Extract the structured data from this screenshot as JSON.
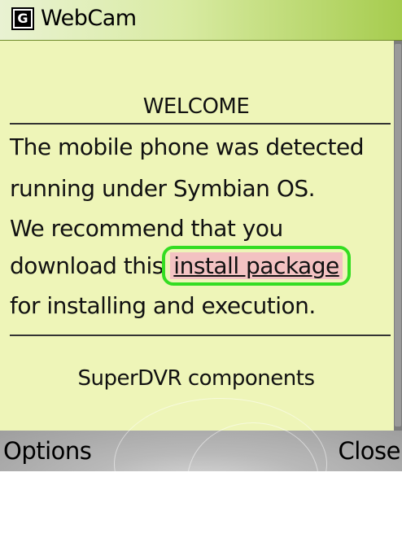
{
  "title_bar": {
    "icon_letter": "G",
    "title": "WebCam"
  },
  "content": {
    "heading": "WELCOME",
    "message": {
      "line1": "The mobile phone was detected",
      "line2": "running under Symbian OS.",
      "line3": "We recommend that you",
      "line4_prefix": "download this",
      "link_text": "install package",
      "line5": "for installing and execution."
    },
    "footer_text": "SuperDVR components"
  },
  "softkeys": {
    "left": "Options",
    "right": "Close"
  },
  "colors": {
    "background": "#eef5b8",
    "link_background": "#f3c2c2",
    "link_highlight_ring": "#33dd22"
  }
}
